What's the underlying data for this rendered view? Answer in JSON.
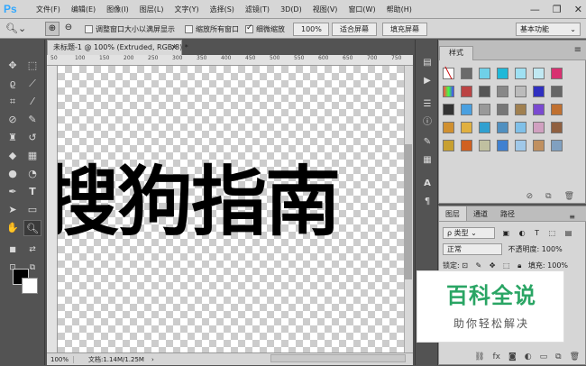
{
  "app": {
    "logo": "Ps"
  },
  "menu": [
    "文件(F)",
    "编辑(E)",
    "图像(I)",
    "图层(L)",
    "文字(Y)",
    "选择(S)",
    "滤镜(T)",
    "3D(D)",
    "视图(V)",
    "窗口(W)",
    "帮助(H)"
  ],
  "window_controls": {
    "minimize": "—",
    "restore": "❐",
    "close": "✕"
  },
  "options": {
    "zoom_icon": "zoom-icon",
    "resize_window": "调整窗口大小以满屏显示",
    "zoom_all": "缩放所有窗口",
    "scrubby_zoom": "细微缩放",
    "scrubby_checked": true,
    "pct_button": "100%",
    "fit_button": "适合屏幕",
    "fill_button": "填充屏幕",
    "workspace": "基本功能"
  },
  "document": {
    "tab_title": "未标题-1 @ 100% (Extruded, RGB/8) *",
    "close": "×",
    "canvas_text": "搜狗指南",
    "ruler_labels": [
      "50",
      "100",
      "150",
      "200",
      "250",
      "300",
      "350",
      "400",
      "450",
      "500",
      "550",
      "600",
      "650",
      "700",
      "750"
    ]
  },
  "status": {
    "zoom": "100%",
    "doc_info": "文档:1.14M/1.25M",
    "arrow": "›"
  },
  "styles_panel": {
    "tab": "样式",
    "menu": "≡"
  },
  "layers_panel": {
    "tabs": [
      "图层",
      "通道",
      "路径"
    ],
    "menu": "≡",
    "filter_label": "ρ 类型",
    "blend_mode": "正常",
    "opacity_label": "不透明度:",
    "opacity_value": "100%",
    "lock_label": "锁定:",
    "fill_label": "填充:",
    "fill_value": "100%"
  },
  "watermark": {
    "title": "百科全说",
    "subtitle": "助你轻松解决"
  },
  "colors": {
    "foreground": "#000000",
    "background": "#ffffff",
    "accent": "#31a8ff",
    "watermark": "#2aa564"
  }
}
